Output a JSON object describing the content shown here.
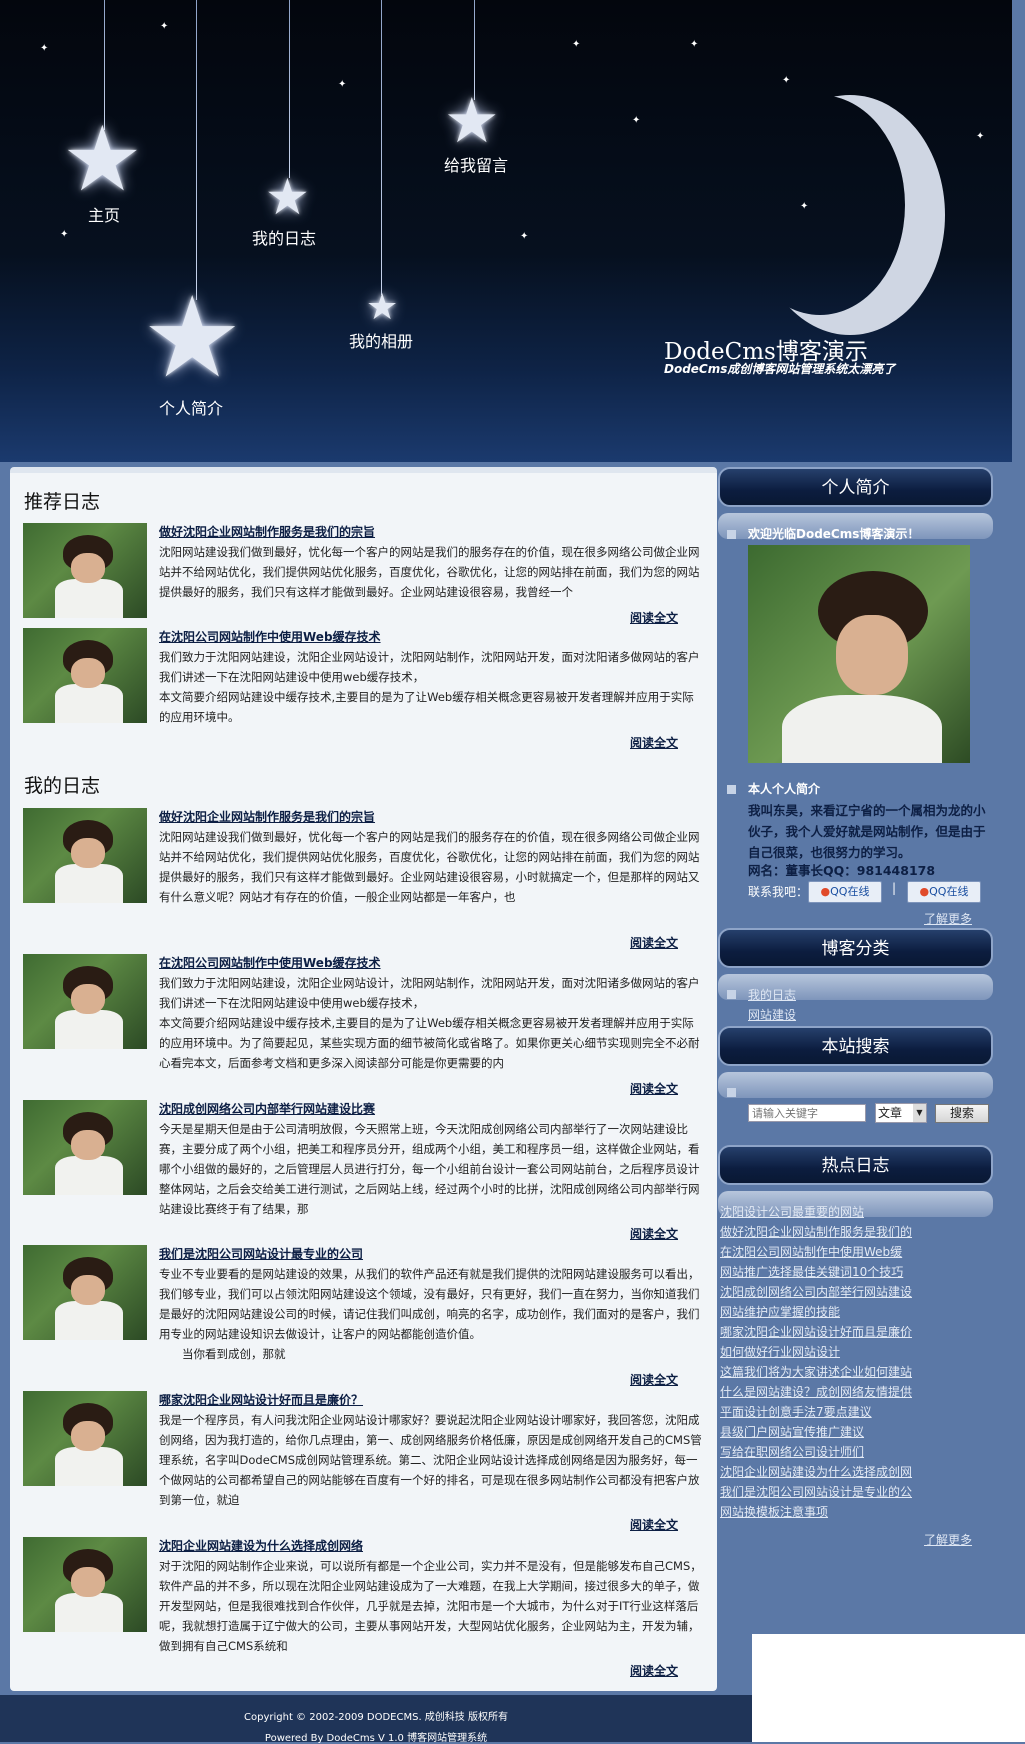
{
  "header": {
    "nav": [
      "主页",
      "我的日志",
      "给我留言",
      "我的相册",
      "个人简介"
    ],
    "title": "DodeCms博客演示",
    "subtitle": "DodeCms成创博客网站管理系统太漂亮了"
  },
  "recommended": {
    "heading": "推荐日志",
    "posts": [
      {
        "title": "做好沈阳企业网站制作服务是我们的宗旨",
        "body": "沈阳网站建设我们做到最好，忧化每一个客户的网站是我们的服务存在的价值，现在很多网络公司做企业网站并不给网站优化，我们提供网站优化服务，百度优化，谷歌优化，让您的网站排在前面，我们为您的网站提供最好的服务，我们只有这样才能做到最好。企业网站建设很容易，我曾经一个",
        "more": "阅读全文"
      },
      {
        "title": "在沈阳公司网站制作中使用Web缓存技术",
        "body": "我们致力于沈阳网站建设，沈阳企业网站设计，沈阳网站制作，沈阳网站开发，面对沈阳诸多做网站的客户我们讲述一下在沈阳网站建设中使用web缓存技术，\n本文简要介绍网站建设中缓存技术,主要目的是为了让Web缓存相关概念更容易被开发者理解并应用于实际的应用环境中。",
        "more": "阅读全文"
      }
    ]
  },
  "mylog": {
    "heading": "我的日志",
    "posts": [
      {
        "title": "做好沈阳企业网站制作服务是我们的宗旨",
        "body": "沈阳网站建设我们做到最好，忧化每一个客户的网站是我们的服务存在的价值，现在很多网络公司做企业网站并不给网站优化，我们提供网站优化服务，百度优化，谷歌优化，让您的网站排在前面，我们为您的网站提供最好的服务，我们只有这样才能做到最好。企业网站建设很容易，小时就搞定一个，但是那样的网站又有什么意义呢？网站才有存在的价值，一般企业网站都是一年客户，也",
        "more": "阅读全文"
      },
      {
        "title": "在沈阳公司网站制作中使用Web缓存技术",
        "body": "我们致力于沈阳网站建设，沈阳企业网站设计，沈阳网站制作，沈阳网站开发，面对沈阳诸多做网站的客户我们讲述一下在沈阳网站建设中使用web缓存技术，\n本文简要介绍网站建设中缓存技术,主要目的是为了让Web缓存相关概念更容易被开发者理解并应用于实际的应用环境中。为了简要起见，某些实现方面的细节被简化或省略了。如果你更关心细节实现则完全不必耐心看完本文，后面参考文档和更多深入阅读部分可能是你更需要的内",
        "more": "阅读全文"
      },
      {
        "title": "沈阳成创网络公司内部举行网站建设比赛",
        "body": "今天是星期天但是由于公司清明放假，今天照常上班，今天沈阳成创网络公司内部举行了一次网站建设比赛，主要分成了两个小组，把美工和程序员分开，组成两个小组，美工和程序员一组，这样做企业网站，看哪个小组做的最好的，之后管理层人员进行打分，每一个小组前台设计一套公司网站前台，之后程序员设计整体网站，之后会交给美工进行测试，之后网站上线，经过两个小时的比拼，沈阳成创网络公司内部举行网站建设比赛终于有了结果，那",
        "more": "阅读全文"
      },
      {
        "title": "我们是沈阳公司网站设计最专业的公司",
        "body": "专业不专业要看的是网站建设的效果，从我们的软件产品还有就是我们提供的沈阳网站建设服务可以看出，我们够专业，我们可以占领沈阳网站建设这个领域，没有最好，只有更好，我们一直在努力，当你知道我们是最好的沈阳网站建设公司的时候，请记住我们叫成创，响亮的名字，成功创作，我们面对的是客户，我们用专业的网站建设知识去做设计，让客户的网站都能创造价值。\n　　当你看到成创，那就",
        "more": "阅读全文"
      },
      {
        "title": "哪家沈阳企业网站设计好而且是廉价？",
        "body": "我是一个程序员，有人问我沈阳企业网站设计哪家好？要说起沈阳企业网站设计哪家好，我回答您，沈阳成创网络，因为我打造的，给你几点理由，第一、成创网络服务价格低廉，原因是成创网络开发自己的CMS管理系统，名字叫DodeCMS成创网站管理系统。第二、沈阳企业网站设计选择成创网络是因为服务好，每一个做网站的公司都希望自己的网站能够在百度有一个好的排名，可是现在很多网站制作公司都没有把客户放到第一位，就迫",
        "more": "阅读全文"
      },
      {
        "title": "沈阳企业网站建设为什么选择成创网络",
        "body": "对于沈阳的网站制作企业来说，可以说所有都是一个企业公司，实力并不是没有，但是能够发布自己CMS，软件产品的并不多，所以现在沈阳企业网站建设成为了一大难题，在我上大学期间，接过很多大的单子，做开发型网站，但是我很难找到合作伙伴，几乎就是去掉，沈阳市是一个大城市，为什么对于IT行业这样落后呢，我就想打造属于辽宁做大的公司，主要从事网站开发，大型网站优化服务，企业网站为主，开发为辅，做到拥有自己CMS系统和",
        "more": "阅读全文"
      }
    ]
  },
  "sidebar": {
    "profile_head": "个人简介",
    "welcome": "欢迎光临DodeCms博客演示！",
    "intro_label": "本人个人简介",
    "intro_text": "我叫东昊，来看辽宁省的一个属相为龙的小伙子，我个人爱好就是网站制作，但是由于自己很菜，也很努力的学习。",
    "name_line": "网名：董事长QQ：981448178",
    "contact_label": "联系我吧：",
    "qq_online": "QQ在线",
    "separator": "|",
    "more": "了解更多",
    "category_head": "博客分类",
    "categories": [
      "我的日志",
      "网站建设"
    ],
    "search_head": "本站搜索",
    "search_placeholder": "请输入关键字",
    "search_select": "文章",
    "search_button": "搜索",
    "hot_head": "热点日志",
    "hot": [
      "沈阳设计公司最重要的网站",
      "做好沈阳企业网站制作服务是我们的",
      "在沈阳公司网站制作中使用Web缓",
      "网站推广选择最佳关键词10个技巧",
      "沈阳成创网络公司内部举行网站建设",
      "网站维护应掌握的技能",
      "哪家沈阳企业网站设计好而且是廉价",
      "如何做好行业网站设计",
      "这篇我们将为大家讲述企业如何建站",
      "什么是网站建设？成创网络友情提供",
      "平面设计创意手法7要点建议",
      "县级门户网站宣传推广建议",
      "写给在职网络公司设计师们",
      "沈阳企业网站建设为什么选择成创网",
      "我们是沈阳公司网站设计是专业的公",
      "网站换模板注意事项"
    ],
    "hot_more": "了解更多"
  },
  "footer": {
    "copyright": "Copyright © 2002-2009 DODECMS. 成创科技 版权所有",
    "powered": "Powered By DodeCms V 1.0 博客网站管理系统"
  }
}
